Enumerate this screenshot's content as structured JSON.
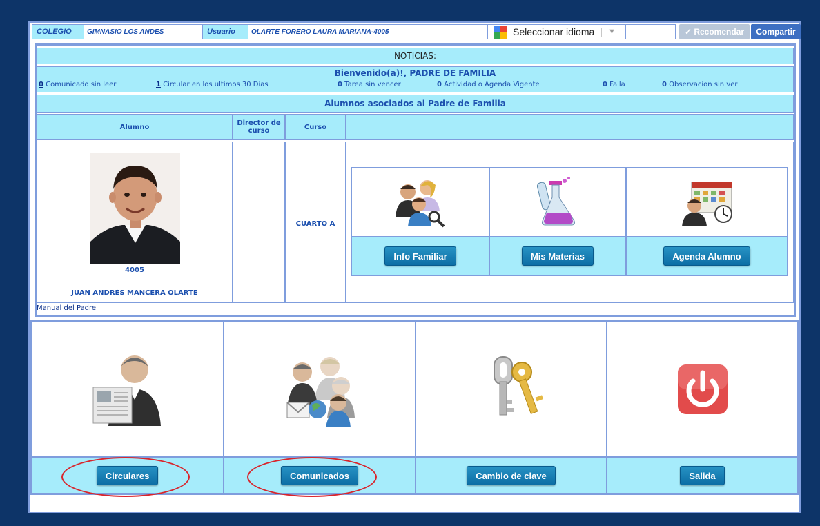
{
  "topbar": {
    "colegio_label": "COLEGIO",
    "colegio_value": "GIMNASIO LOS ANDES",
    "usuario_label": "Usuario",
    "usuario_value": "OLARTE FORERO LAURA MARIANA-4005",
    "language_select": "Seleccionar idioma",
    "recommend_label": "✓ Recomendar",
    "share_label": "Compartir"
  },
  "news": {
    "title": "NOTICIAS:",
    "welcome": "Bienvenido(a)!, PADRE DE FAMILIA",
    "stats": [
      {
        "count": "0",
        "label": "Comunicado sin leer",
        "link": true
      },
      {
        "count": "1",
        "label": "Circular en los ultimos 30 Dias",
        "link": true
      },
      {
        "count": "0",
        "label": "Tarea sin vencer",
        "link": false
      },
      {
        "count": "0",
        "label": "Actividad o Agenda Vigente",
        "link": false
      },
      {
        "count": "0",
        "label": "Falla",
        "link": false
      },
      {
        "count": "0",
        "label": "Observacion sin ver",
        "link": false
      }
    ],
    "students_title": "Alumnos asociados al Padre de Familia",
    "columns": [
      "Alumno",
      "Director de curso",
      "Curso"
    ],
    "student": {
      "code": "4005",
      "name": "JUAN ANDRÉS MANCERA OLARTE",
      "curso": "CUARTO A",
      "director": ""
    },
    "actions": [
      {
        "label": "Info Familiar",
        "icon": "family-info-icon"
      },
      {
        "label": "Mis Materias",
        "icon": "subjects-flask-icon"
      },
      {
        "label": "Agenda Alumno",
        "icon": "calendar-agenda-icon"
      }
    ],
    "manual_link": "Manual del Padre"
  },
  "menu": [
    {
      "label": "Circulares",
      "icon": "newspaper-person-icon"
    },
    {
      "label": "Comunicados",
      "icon": "people-globe-mail-icon"
    },
    {
      "label": "Cambio de clave",
      "icon": "keys-icon"
    },
    {
      "label": "Salida",
      "icon": "power-icon"
    }
  ],
  "colors": {
    "page_bg": "#0d3468",
    "header_bg": "#a6ecfb",
    "border": "#7f9ddd",
    "text_blue": "#1b4fae",
    "button": "#0c6ea5",
    "highlight_oval": "#d9252c"
  }
}
